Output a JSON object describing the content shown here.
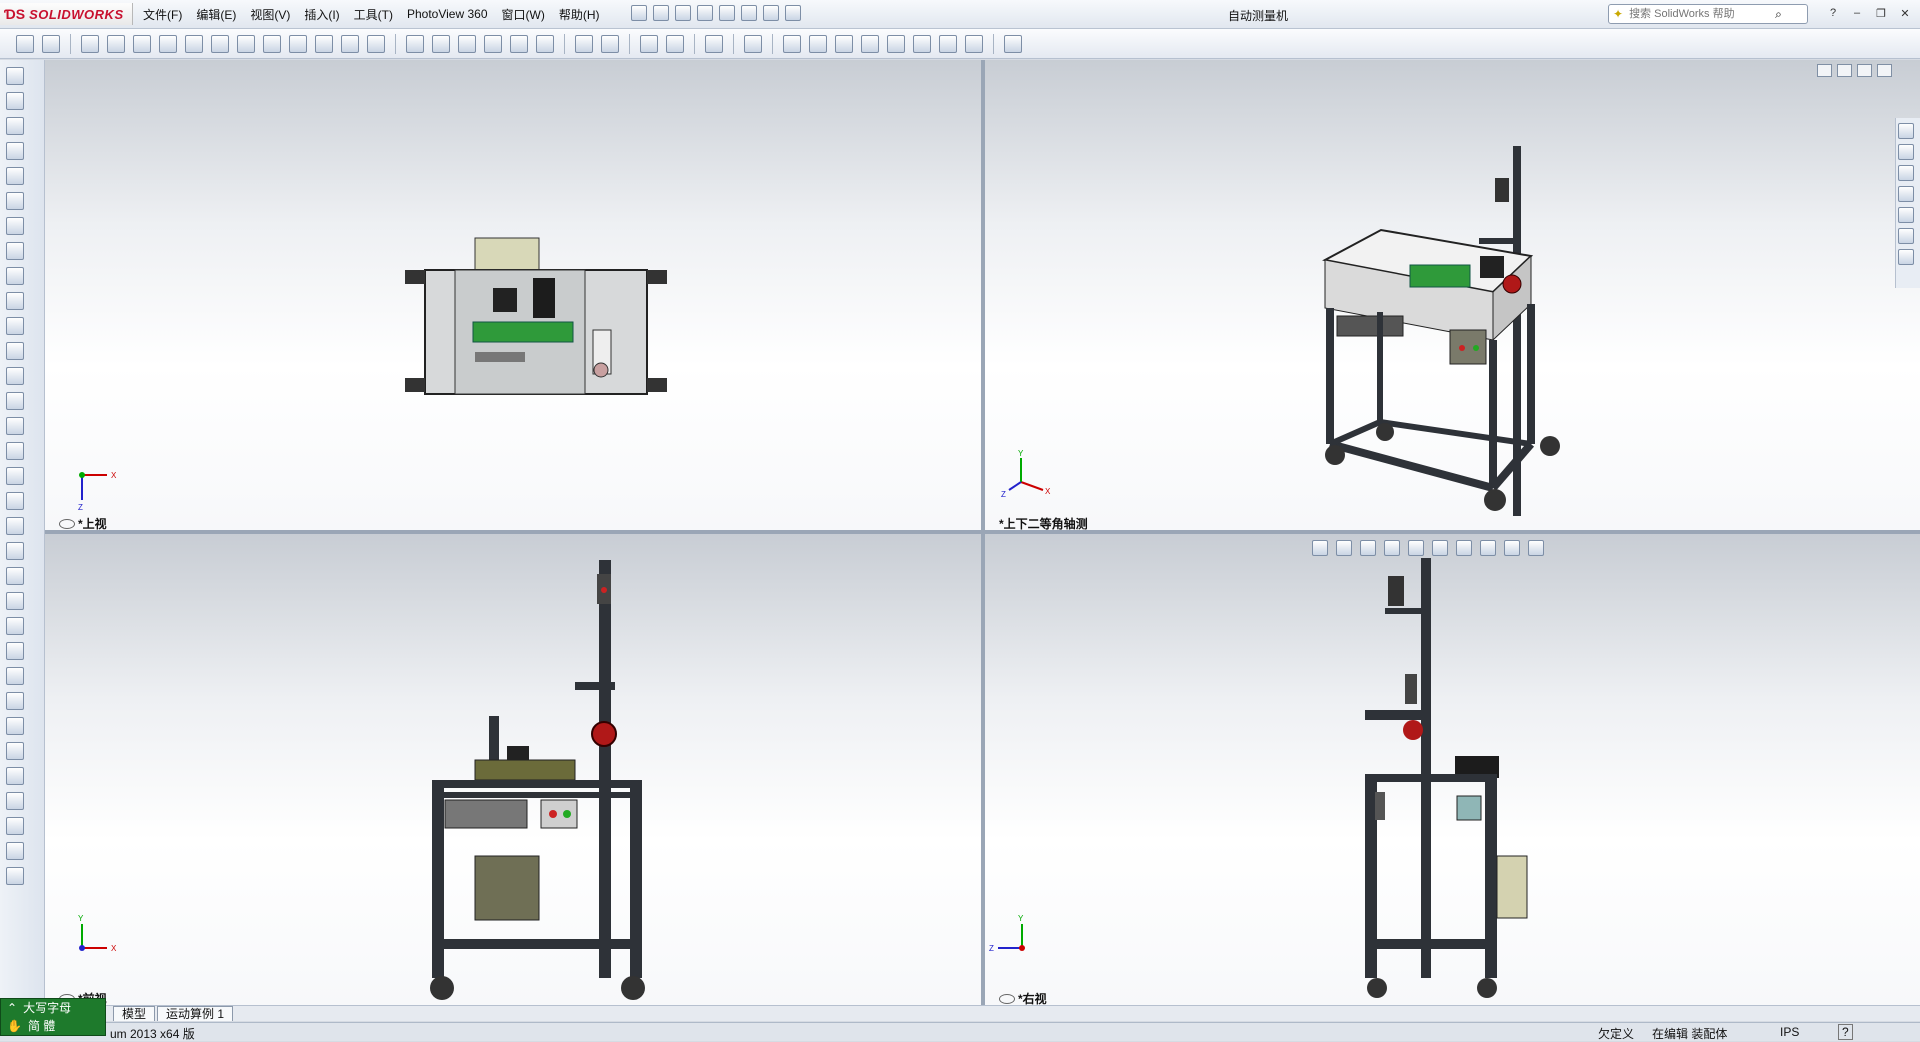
{
  "app": {
    "logo": "SOLIDWORKS",
    "doc_title": "自动测量机"
  },
  "menu": {
    "items": [
      "文件(F)",
      "编辑(E)",
      "视图(V)",
      "插入(I)",
      "工具(T)",
      "PhotoView 360",
      "窗口(W)",
      "帮助(H)"
    ]
  },
  "search": {
    "placeholder": "搜索 SolidWorks 帮助"
  },
  "viewports": {
    "top": {
      "label": "*上视"
    },
    "iso": {
      "label": "*上下二等角轴测"
    },
    "front": {
      "label": "*前视"
    },
    "right": {
      "label": "*右视"
    }
  },
  "triad": {
    "x": "X",
    "y": "Y",
    "z": "Z"
  },
  "tabs": [
    "模型",
    "运动算例 1"
  ],
  "status": {
    "version": "um 2013 x64 版",
    "defined": "欠定义",
    "editing": "在编辑 装配体",
    "units": "IPS",
    "help": "?"
  },
  "ime": {
    "mode": "大写字母",
    "status": "简 體"
  },
  "colors": {
    "logo_red": "#c8102e",
    "frame_dark": "#2e3238",
    "panel_gray": "#d7d9da",
    "pcb_green": "#2f9a3a"
  }
}
